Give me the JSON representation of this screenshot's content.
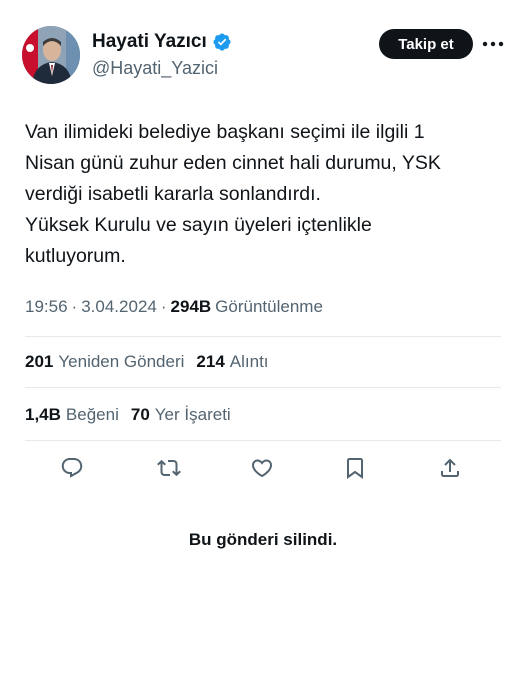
{
  "author": {
    "name": "Hayati Yazıcı",
    "handle": "@Hayati_Yazici"
  },
  "follow_button_label": "Takip et",
  "tweet": {
    "lines": [
      "Van ilimideki belediye başkanı seçimi ile ilgili 1",
      "Nisan günü zuhur eden cinnet hali durumu, YSK",
      "verdiği isabetli kararla sonlandırdı.",
      "Yüksek Kurulu ve sayın üyeleri içtenlikle",
      "kutluyorum."
    ]
  },
  "meta": {
    "time": "19:56",
    "date": "3.04.2024",
    "views_count": "294B",
    "views_label": "Görüntülenme"
  },
  "stats_row1": {
    "retweets_count": "201",
    "retweets_label": "Yeniden Gönderi",
    "quotes_count": "214",
    "quotes_label": "Alıntı"
  },
  "stats_row2": {
    "likes_count": "1,4B",
    "likes_label": "Beğeni",
    "bookmarks_count": "70",
    "bookmarks_label": "Yer İşareti"
  },
  "actions": [
    "reply-icon",
    "retweet-icon",
    "like-icon",
    "bookmark-icon",
    "share-icon"
  ],
  "deleted_notice": "Bu gönderi silindi.",
  "colors": {
    "text": "#0f1419",
    "secondary": "#536471",
    "verified": "#1d9bf0",
    "divider": "#e7e9ea"
  }
}
